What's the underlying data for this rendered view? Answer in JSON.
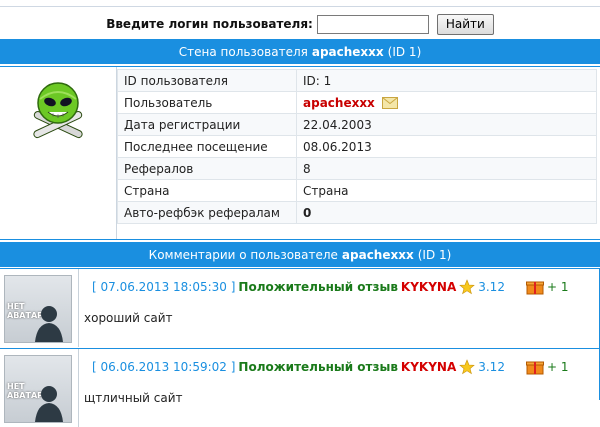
{
  "search": {
    "label": "Введите логин пользователя:",
    "input_value": "",
    "button_label": "Найти"
  },
  "wall_header": {
    "prefix": "Стена пользователя",
    "username": "apachexxx",
    "id_text": "(ID 1)"
  },
  "profile": {
    "rows": [
      {
        "key": "ID пользователя",
        "value": "ID: 1"
      },
      {
        "key": "Пользователь",
        "value": "apachexxx"
      },
      {
        "key": "Дата регистрации",
        "value": "22.04.2003"
      },
      {
        "key": "Последнее посещение",
        "value": "08.06.2013"
      },
      {
        "key": "Рефералов",
        "value": "8"
      },
      {
        "key": "Страна",
        "value": "Страна"
      },
      {
        "key": "Авто-рефбэк рефералам",
        "value": "0"
      }
    ]
  },
  "comments_header": {
    "prefix": "Комментарии о пользователе",
    "username": "apachexxx",
    "id_text": "(ID 1)"
  },
  "comments": [
    {
      "avatar_label": "НЕТ АВАТАРА",
      "date": "[ 07.06.2013 18:05:30 ]",
      "type": "Положительный отзыв",
      "author": "KYKYNA",
      "rating": "3.12",
      "plus": "+ 1",
      "text": "хороший сайт"
    },
    {
      "avatar_label": "НЕТ АВАТАРА",
      "date": "[ 06.06.2013 10:59:02 ]",
      "type": "Положительный отзыв",
      "author": "KYKYNA",
      "rating": "3.12",
      "plus": "+ 1",
      "text": "щтличный сайт"
    }
  ],
  "colors": {
    "header_bg": "#1a8fe0",
    "username": "#c80000",
    "positive": "#1a7a1a"
  }
}
